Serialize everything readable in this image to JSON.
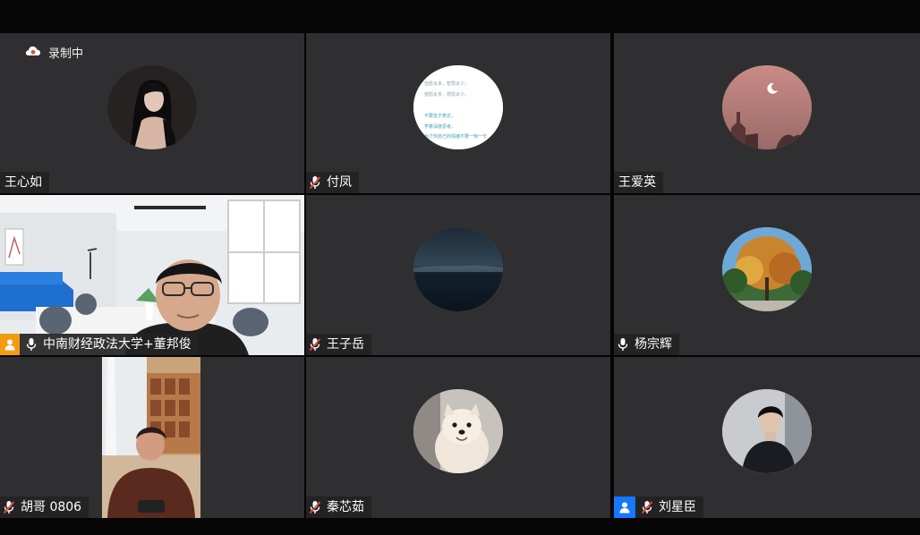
{
  "recording": {
    "label": "录制中"
  },
  "participants": [
    {
      "name": "王心如"
    },
    {
      "name": "付凤"
    },
    {
      "name": "王爱英"
    },
    {
      "name": "中南财经政法大学+董邦俊"
    },
    {
      "name": "王子岳"
    },
    {
      "name": "杨宗辉"
    },
    {
      "name": "胡哥 0806"
    },
    {
      "name": "秦芯茹"
    },
    {
      "name": "刘星臣"
    }
  ],
  "avatar_text": {
    "line1": "但愿太多，智慧太少；",
    "line2": "抱怨太多，感恩太少。",
    "line3": "不要急于表达，",
    "line4": "学着深度思考，",
    "line5": "为了你自己的情绪不要一惊一乍"
  },
  "colors": {
    "background": "#050505",
    "tile": "#2f2f31",
    "active_border": "#2ecc71",
    "host_badge": "#f39c12",
    "cohost_badge": "#1677ff"
  }
}
